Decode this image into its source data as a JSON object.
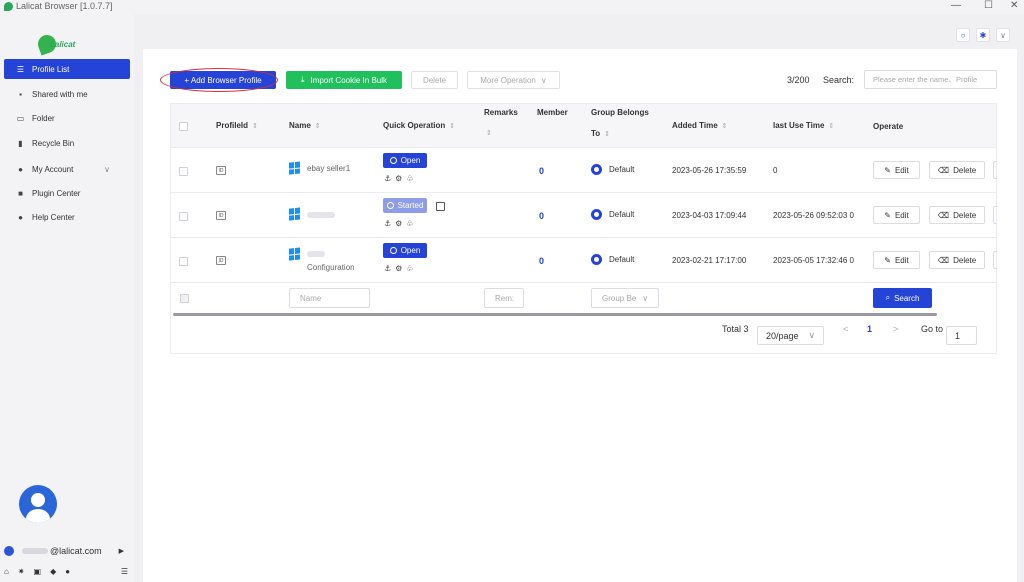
{
  "window": {
    "title": "Lalicat Browser  [1.0.7.7]",
    "controls": [
      "—",
      "☐",
      "✕"
    ]
  },
  "sidebar": {
    "brand": "Lalicat",
    "items": [
      {
        "label": "Profile List",
        "icon": "list-icon",
        "active": true
      },
      {
        "label": "Shared with me",
        "icon": "share-icon"
      },
      {
        "label": "Folder",
        "icon": "folder-icon"
      },
      {
        "label": "Recycle Bin",
        "icon": "trash-icon"
      },
      {
        "label": "My Account",
        "icon": "account-icon",
        "expandable": true
      },
      {
        "label": "Plugin Center",
        "icon": "grid-icon"
      },
      {
        "label": "Help Center",
        "icon": "help-icon"
      }
    ],
    "account_email": "@lalicat.com",
    "bottom_icons": [
      "home-icon",
      "sun-icon",
      "linkedin-icon",
      "tag-icon",
      "shield-icon",
      "menu-icon"
    ]
  },
  "toolbar": {
    "add_profile": "+ Add Browser Profile",
    "import_cookie": "Import Cookie In Bulk",
    "delete": "Delete",
    "more_operation": "More Operation",
    "count": "3/200",
    "search_label": "Search:",
    "search_placeholder": "Please enter the name、Profile"
  },
  "table": {
    "headers": {
      "profile_id": "ProfileId",
      "name": "Name",
      "quick_operation": "Quick Operation",
      "remarks": "Remarks",
      "member": "Member",
      "group_line1": "Group Belongs",
      "group_line2": "To",
      "added_time": "Added Time",
      "last_use_time": "last Use Time",
      "operate": "Operate"
    },
    "rows": [
      {
        "name": "ebay seller1",
        "subname": "",
        "status": "Open",
        "member": "0",
        "group": "Default",
        "added": "2023-05-26 17:35:59",
        "last_use": "0"
      },
      {
        "name": "",
        "subname": "",
        "status": "Started",
        "member": "0",
        "group": "Default",
        "added": "2023-04-03 17:09:44",
        "last_use": "2023-05-26 09:52:03 0"
      },
      {
        "name": "",
        "subname": "Configuration",
        "status": "Open",
        "member": "0",
        "group": "Default",
        "added": "2023-02-21 17:17:00",
        "last_use": "2023-05-05 17:32:46 0"
      }
    ],
    "edit_label": "Edit",
    "delete_label": "Delete",
    "id_badge": "ID",
    "filter": {
      "name_placeholder": "Name",
      "remarks_placeholder": "Rem:",
      "group_placeholder": "Group Be",
      "search_button": "Search"
    }
  },
  "pagination": {
    "total": "Total 3",
    "page_size": "20/page",
    "current_page": "1",
    "goto_label": "Go to",
    "goto_value": "1"
  },
  "colors": {
    "primary": "#2643d8",
    "green": "#20c05c",
    "started": "#8f9de8",
    "highlight": "#d83030"
  }
}
